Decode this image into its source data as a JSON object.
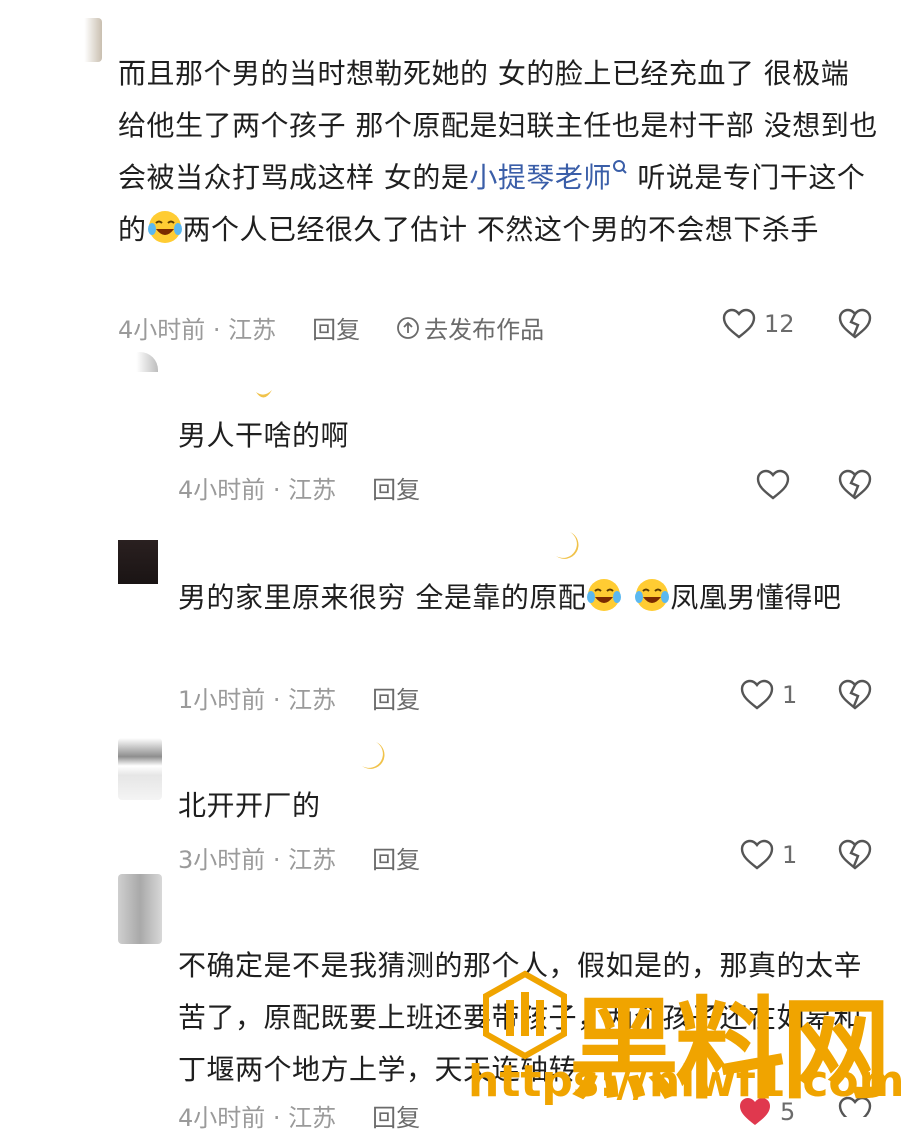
{
  "comments": [
    {
      "text_parts": [
        "而且那个男的当时想勒死她的 女的脸上已经充血了 很极端 给他生了两个孩子 那个原配是妇联主任也是村干部 没想到也会被当众打骂成这样 女的是",
        "小提琴老师",
        " 听说是专门干这个的",
        "两个人已经很久了估计 不然这个男的不会想下杀手"
      ],
      "time": "4小时前 · 江苏",
      "reply": "回复",
      "go_label": "去发布作品",
      "likes": "12"
    },
    {
      "text": "男人干啥的啊",
      "time": "4小时前 · 江苏",
      "reply": "回复",
      "likes": ""
    },
    {
      "text_parts": [
        "男的家里原来很穷 全是靠的原配",
        "凤凰男懂得吧"
      ],
      "time": "1小时前 · 江苏",
      "reply": "回复",
      "likes": "1"
    },
    {
      "text": "北开开厂的",
      "time": "3小时前 · 江苏",
      "reply": "回复",
      "likes": "1"
    },
    {
      "text": "不确定是不是我猜测的那个人，假如是的，那真的太辛苦了，原配既要上班还要带孩子，两个孩子还在如皋和丁堰两个地方上学，天天连轴转",
      "time": "4小时前 · 江苏",
      "reply": "回复",
      "likes": "5"
    }
  ],
  "watermark": {
    "brand": "黑料网",
    "url": "https://hlwf1.com"
  },
  "colors": {
    "link": "#3a5ea8",
    "meta": "#9a9a9a",
    "watermark": "#f0a400"
  }
}
